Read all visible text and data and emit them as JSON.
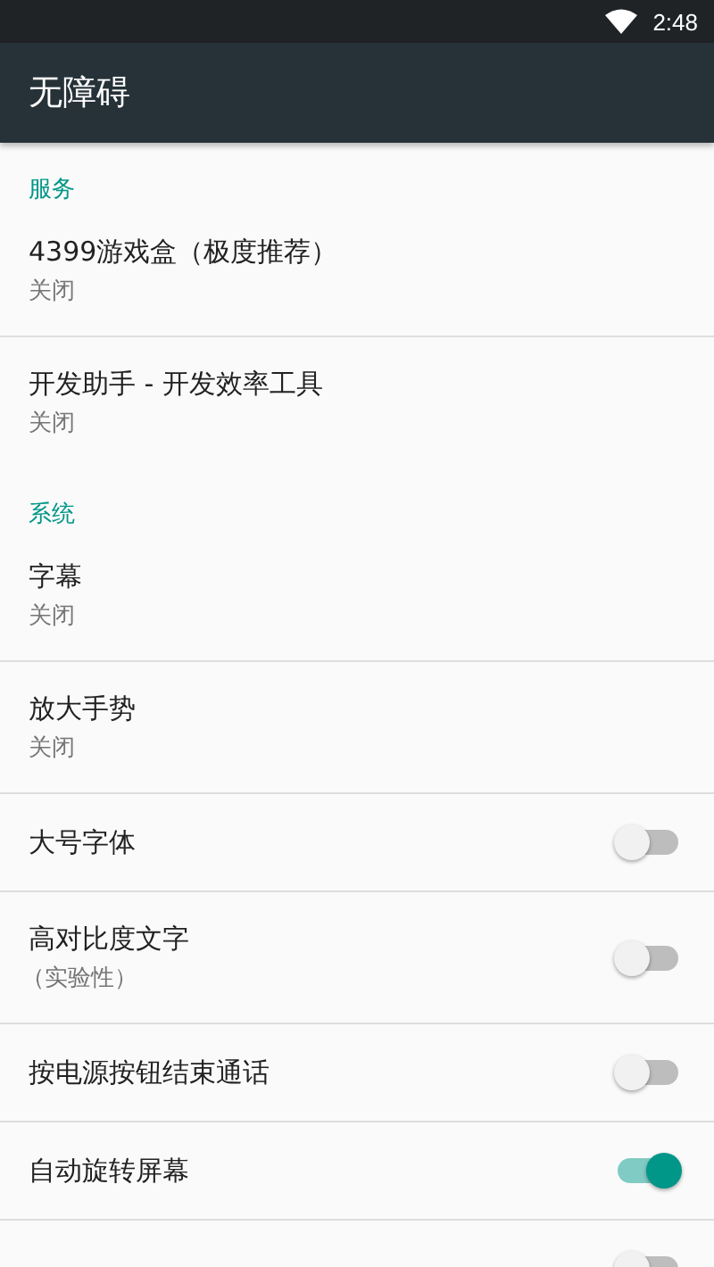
{
  "status_bar": {
    "time": "2:48"
  },
  "toolbar": {
    "title": "无障碍"
  },
  "sections": [
    {
      "header": "服务",
      "items": [
        {
          "kind": "link",
          "title": "4399游戏盒（极度推荐）",
          "summary": "关闭"
        },
        {
          "kind": "link",
          "title": "开发助手 - 开发效率工具",
          "summary": "关闭"
        }
      ]
    },
    {
      "header": "系统",
      "items": [
        {
          "kind": "link",
          "title": "字幕",
          "summary": "关闭"
        },
        {
          "kind": "link",
          "title": "放大手势",
          "summary": "关闭"
        },
        {
          "kind": "switch",
          "title": "大号字体",
          "on": false
        },
        {
          "kind": "switch",
          "title": "高对比度文字",
          "summary": "（实验性）",
          "on": false
        },
        {
          "kind": "switch",
          "title": "按电源按钮结束通话",
          "on": false
        },
        {
          "kind": "switch",
          "title": "自动旋转屏幕",
          "on": true
        },
        {
          "kind": "switch",
          "on": false
        }
      ]
    }
  ]
}
